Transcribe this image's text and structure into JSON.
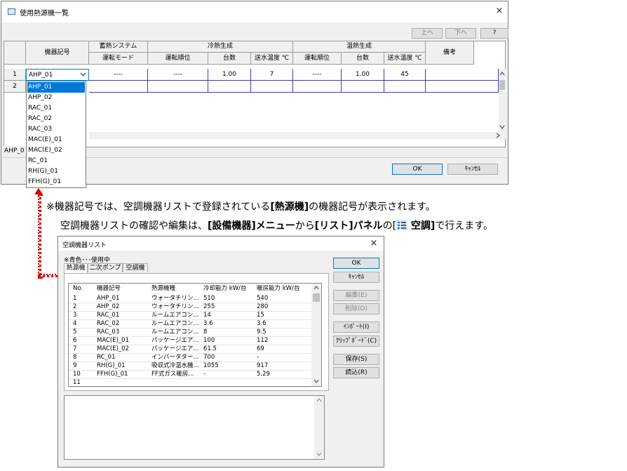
{
  "main_dialog": {
    "title": "使用熱源機一覧",
    "close_glyph": "×",
    "btn_up": "上へ",
    "btn_down": "下へ",
    "btn_help": "?",
    "header": {
      "kiki_kigou": "機器記号",
      "chikunetsu": "蓄熱システム",
      "unten_mode": "運転モード",
      "reinetsu": "冷熱生成",
      "onnetsu": "温熱生成",
      "unten_juni": "運転順位",
      "daisu": "台数",
      "soushui_ondo": "送水温度 ℃",
      "bikou": "備考"
    },
    "rows": [
      {
        "no": "1",
        "kiki": "AHP_01",
        "mode": "----",
        "r_juni": "----",
        "r_daisu": "1.00",
        "r_ondo": "7",
        "o_juni": "----",
        "o_daisu": "1.00",
        "o_ondo": "45",
        "bikou": ""
      },
      {
        "no": "2",
        "kiki": "",
        "mode": "",
        "r_juni": "",
        "r_daisu": "",
        "r_ondo": "",
        "o_juni": "",
        "o_daisu": "",
        "o_ondo": "",
        "bikou": ""
      }
    ],
    "status_text": "AHP_0",
    "ok": "OK",
    "cancel": "ｷｬﾝｾﾙ",
    "dropdown_items": [
      "AHP_01",
      "AHP_02",
      "RAC_01",
      "RAC_02",
      "RAC_03",
      "MAC(E)_01",
      "MAC(E)_02",
      "RC_01",
      "RH(G)_01",
      "FFH(G)_01"
    ],
    "dropdown_selected": "AHP_01"
  },
  "note": {
    "line1_a": "※機器記号では、空調機器リストで登録されている",
    "line1_b": "[熱源機]",
    "line1_c": "の機器記号が表示されます。",
    "line2_a": "空調機器リストの確認や編集は、",
    "line2_b": "[設備機器]メニュー",
    "line2_c": "から",
    "line2_d": "[リスト]パネル",
    "line2_e": "の[",
    "line2_f": " 空調]",
    "line2_g": "で行えます。"
  },
  "list_dialog": {
    "title": "空調機器リスト",
    "close_glyph": "×",
    "legend": "※青色･･･使用中",
    "tabs": [
      "熱源機",
      "二次ポンプ",
      "空調機"
    ],
    "columns": [
      "No.",
      "機器記号",
      "熱源機種",
      "冷却能力 kW/台",
      "暖房能力 kW/台"
    ],
    "rows": [
      [
        "1",
        "AHP_01",
        "ウォータチリン...",
        "510",
        "540"
      ],
      [
        "2",
        "AHP_02",
        "ウォータチリン...",
        "255",
        "280"
      ],
      [
        "3",
        "RAC_01",
        "ルームエアコン...",
        "14",
        "15"
      ],
      [
        "4",
        "RAC_02",
        "ルームエアコン...",
        "3.6",
        "3.6"
      ],
      [
        "5",
        "RAC_03",
        "ルームエアコン...",
        "8",
        "9.5"
      ],
      [
        "6",
        "MAC(E)_01",
        "パッケージエア...",
        "100",
        "112"
      ],
      [
        "7",
        "MAC(E)_02",
        "パッケージエア...",
        "61.5",
        "69"
      ],
      [
        "8",
        "RC_01",
        "インバータター...",
        "700",
        "-"
      ],
      [
        "9",
        "RH(G)_01",
        "吸収式冷温水機...",
        "1055",
        "917"
      ],
      [
        "10",
        "FFH(G)_01",
        "FF式ガス暖房...",
        "-",
        "5.29"
      ],
      [
        "11",
        "",
        "",
        "",
        ""
      ]
    ],
    "buttons": {
      "ok": "OK",
      "cancel": "ｷｬﾝｾﾙ",
      "edit": "編集(E)",
      "delete": "削除(D)",
      "import": "ｲﾝﾎﾟｰﾄ(I)",
      "clipboard": "ｸﾘｯﾌﾟﾎﾞｰﾄﾞ(C)",
      "save": "保存(S)",
      "load": "読込(R)"
    }
  },
  "colors": {
    "selection": "#0078d7",
    "annotation_red": "#d40000",
    "accent_border": "#0078d7"
  },
  "icons": {
    "dropdown": "chevron-down-icon",
    "scroll_up": "chevron-up-icon",
    "scroll_down": "chevron-down-icon",
    "panel_icon": "list-icon"
  }
}
